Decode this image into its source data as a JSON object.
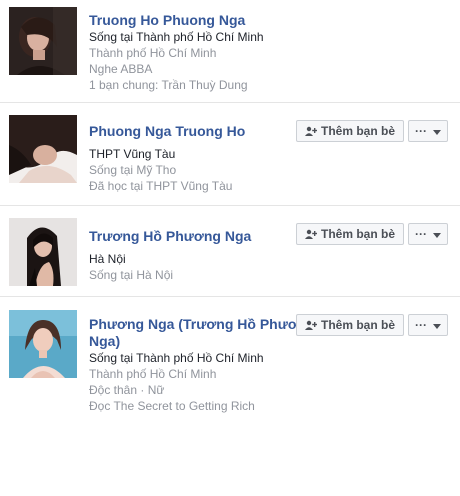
{
  "results": [
    {
      "name": "Truong Ho Phuong Nga",
      "lines": [
        "Sống tại Thành phố Hồ Chí Minh",
        "Thành phố Hồ Chí Minh",
        "Nghe ABBA",
        "1 bạn chung: Trần Thuỳ Dung"
      ],
      "has_actions": false
    },
    {
      "name": "Phuong Nga Truong Ho",
      "lines": [
        "THPT Vũng Tàu",
        "Sống tại Mỹ Tho",
        "Đã học tại THPT Vũng Tàu"
      ],
      "has_actions": true
    },
    {
      "name": "Trương Hồ Phương Nga",
      "lines": [
        "Hà Nội",
        "Sống tại Hà Nội"
      ],
      "has_actions": true
    },
    {
      "name": "Phương Nga (Trương Hồ Phương Nga)",
      "lines": [
        "Sống tại Thành phố Hồ Chí Minh",
        "Thành phố Hồ Chí Minh",
        "Độc thân · Nữ",
        "Đọc The Secret to Getting Rich"
      ],
      "has_actions": true
    }
  ],
  "actions": {
    "add_friend_label": "Thêm bạn bè",
    "more_label": "···",
    "add_friend_icon": "add-friend-icon",
    "more_icon": "chevron-down-icon"
  },
  "colors": {
    "link": "#365899",
    "secondary_text": "#90949c",
    "button_bg": "#f6f7f9",
    "button_border": "#ccd0d5"
  }
}
